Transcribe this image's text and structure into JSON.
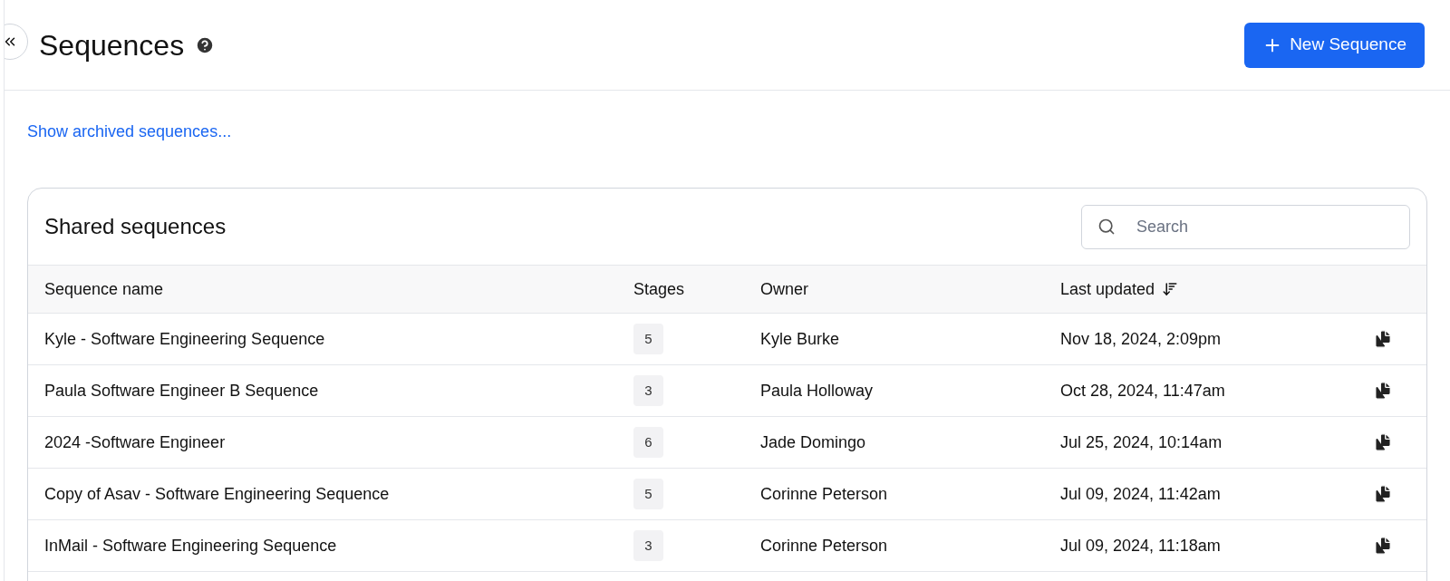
{
  "header": {
    "title": "Sequences",
    "new_button": "New Sequence"
  },
  "archived_link": "Show archived sequences...",
  "card": {
    "title": "Shared sequences",
    "search": {
      "placeholder": "Search"
    }
  },
  "table": {
    "columns": [
      "Sequence name",
      "Stages",
      "Owner",
      "Last updated"
    ],
    "rows": [
      {
        "name": "Kyle - Software Engineering Sequence",
        "stages": "5",
        "owner": "Kyle Burke",
        "updated": "Nov 18, 2024, 2:09pm"
      },
      {
        "name": "Paula Software Engineer B Sequence",
        "stages": "3",
        "owner": "Paula Holloway",
        "updated": "Oct 28, 2024, 11:47am"
      },
      {
        "name": "2024 -Software Engineer",
        "stages": "6",
        "owner": "Jade Domingo",
        "updated": "Jul 25, 2024, 10:14am"
      },
      {
        "name": "Copy of Asav - Software Engineering Sequence",
        "stages": "5",
        "owner": "Corinne Peterson",
        "updated": "Jul 09, 2024, 11:42am"
      },
      {
        "name": "InMail - Software Engineering Sequence",
        "stages": "3",
        "owner": "Corinne Peterson",
        "updated": "Jul 09, 2024, 11:18am"
      }
    ]
  }
}
